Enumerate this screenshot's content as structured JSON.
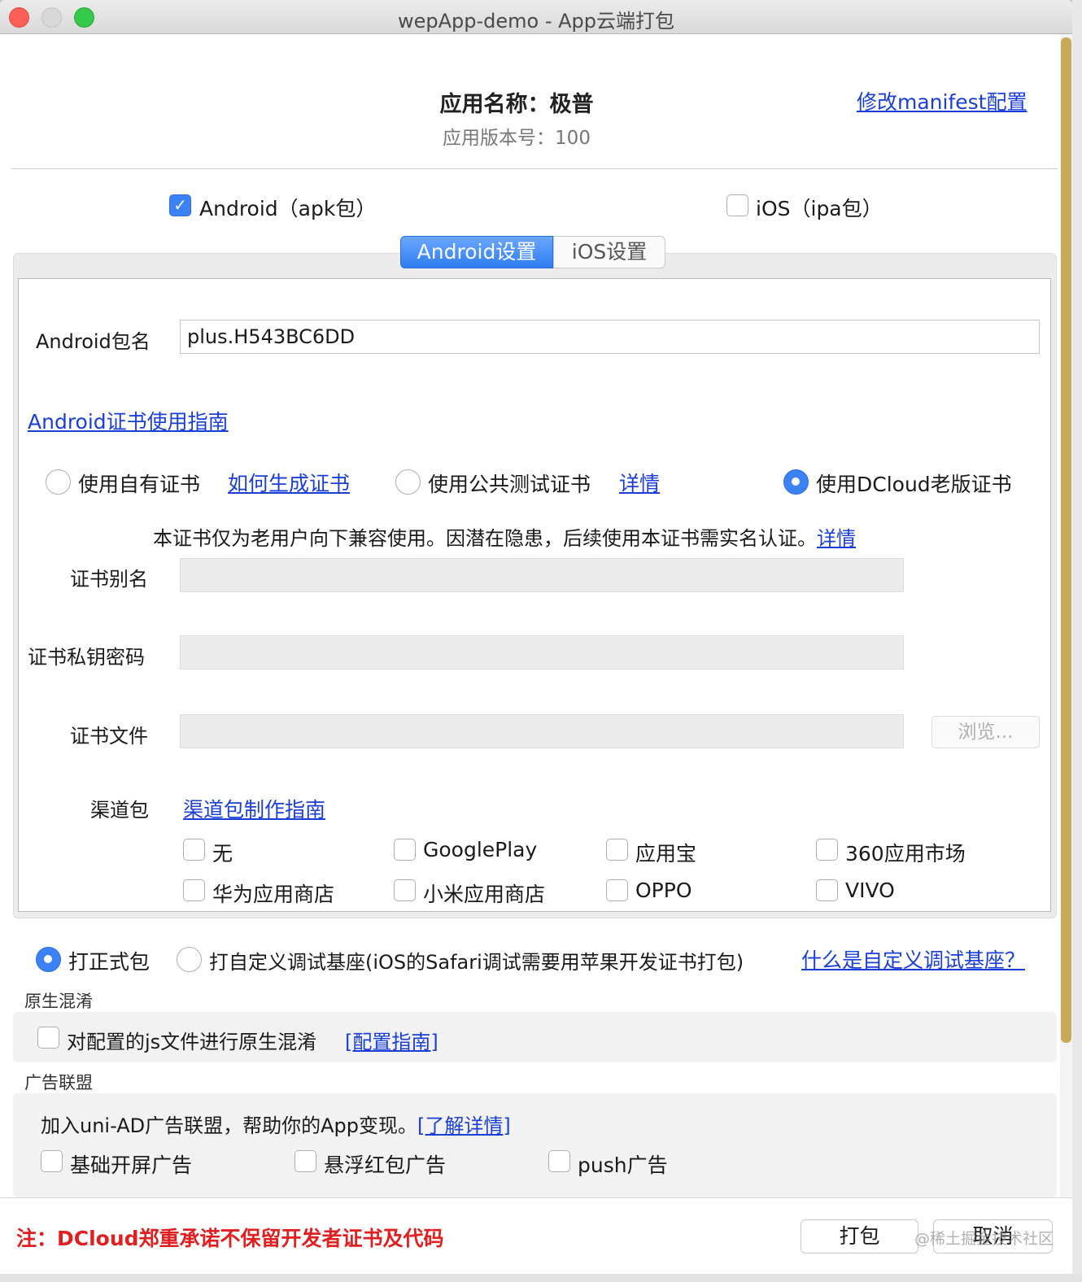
{
  "window": {
    "title": "wepApp-demo - App云端打包"
  },
  "app": {
    "name": "应用名称：极普",
    "version": "应用版本号：100",
    "manifest_link": "修改manifest配置"
  },
  "platforms": [
    {
      "label": "Android（apk包）",
      "checked": true
    },
    {
      "label": "iOS（ipa包）",
      "checked": false
    }
  ],
  "tabs": {
    "android": "Android设置",
    "ios": "iOS设置",
    "active": "android"
  },
  "android": {
    "package_label": "Android包名",
    "package_value": "plus.H543BC6DD",
    "cert_guide_link": "Android证书使用指南",
    "cert_options": {
      "own": "使用自有证书",
      "own_link": "如何生成证书",
      "public": "使用公共测试证书",
      "public_link": "详情",
      "dcloud": "使用DCloud老版证书",
      "selected": "dcloud"
    },
    "notice": "本证书仅为老用户向下兼容使用。因潜在隐患，后续使用本证书需实名认证。",
    "notice_link": "详情",
    "alias_label": "证书别名",
    "password_label": "证书私钥密码",
    "file_label": "证书文件",
    "browse_button": "浏览...",
    "channel_label": "渠道包",
    "channel_link": "渠道包制作指南",
    "channels": [
      "无",
      "GooglePlay",
      "应用宝",
      "360应用市场",
      "华为应用商店",
      "小米应用商店",
      "OPPO",
      "VIVO"
    ]
  },
  "build_type": {
    "release": "打正式包",
    "custom": "打自定义调试基座(iOS的Safari调试需要用苹果开发证书打包)",
    "custom_link": "什么是自定义调试基座？",
    "selected": "release"
  },
  "obfuscation": {
    "title": "原生混淆",
    "option": "对配置的js文件进行原生混淆",
    "link": "[配置指南]"
  },
  "ads": {
    "title": "广告联盟",
    "description": "加入uni-AD广告联盟，帮助你的App变现。",
    "link": "[了解详情]",
    "options": [
      "基础开屏广告",
      "悬浮红包广告",
      "push广告"
    ]
  },
  "footer": {
    "notice": "注：DCloud郑重承诺不保留开发者证书及代码",
    "pack_button": "打包",
    "cancel_button": "取消",
    "watermark": "@稀土掘金技术社区"
  }
}
